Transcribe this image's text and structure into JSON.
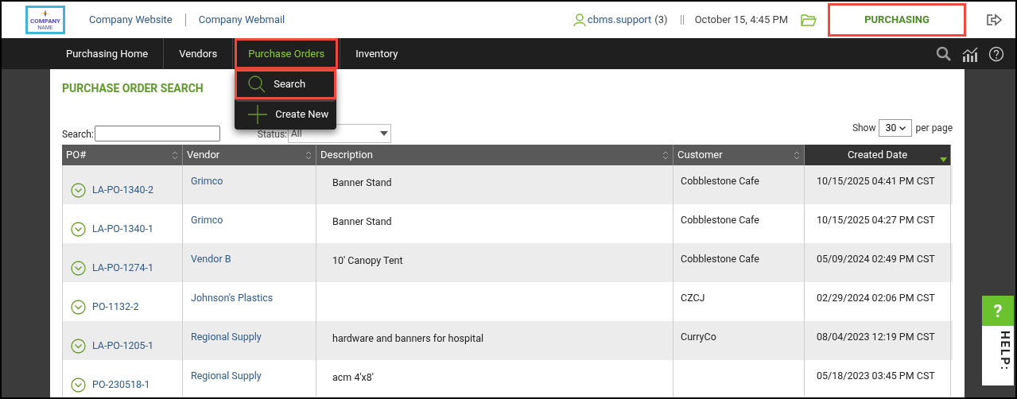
{
  "header": {
    "logo_text": "COMPANY",
    "logo_subtext": "NAME",
    "links": [
      "Company Website",
      "Company Webmail"
    ],
    "user": "cbms.support",
    "user_count": "(3)",
    "datetime": "October 15, 4:45 PM",
    "module": {
      "label": "PURCHASING",
      "highlighted": true
    }
  },
  "nav": {
    "items": [
      {
        "label": "Purchasing Home",
        "selected": false,
        "highlighted": false
      },
      {
        "label": "Vendors",
        "selected": false,
        "highlighted": false
      },
      {
        "label": "Purchase Orders",
        "selected": true,
        "highlighted": true
      },
      {
        "label": "Inventory",
        "selected": false,
        "highlighted": false
      }
    ]
  },
  "dropdown": [
    {
      "kind": "search",
      "label": "Search",
      "highlighted": true
    },
    {
      "kind": "create",
      "label": "Create New",
      "highlighted": false
    }
  ],
  "page": {
    "title": "PURCHASE ORDER SEARCH",
    "search_label": "Search:",
    "status_label": "Status:",
    "status_value": "All",
    "show_label": "Show",
    "per_page_value": "30",
    "per_page_label": "per page"
  },
  "table": {
    "columns": [
      {
        "label": "PO#",
        "sorted": false
      },
      {
        "label": "Vendor",
        "sorted": false
      },
      {
        "label": "Description",
        "sorted": false
      },
      {
        "label": "Customer",
        "sorted": false
      },
      {
        "label": "Created Date",
        "sorted": true
      }
    ],
    "rows": [
      {
        "po": "LA-PO-1340-2",
        "vendor": "Grimco",
        "description": "Banner Stand",
        "customer": "Cobblestone Cafe",
        "created": "10/15/2025 04:41 PM CST"
      },
      {
        "po": "LA-PO-1340-1",
        "vendor": "Grimco",
        "description": "Banner Stand",
        "customer": "Cobblestone Cafe",
        "created": "10/15/2025 04:27 PM CST"
      },
      {
        "po": "LA-PO-1274-1",
        "vendor": "Vendor B",
        "description": "10' Canopy Tent",
        "customer": "Cobblestone Cafe",
        "created": "05/09/2024 02:49 PM CST"
      },
      {
        "po": "PO-1132-2",
        "vendor": "Johnson's Plastics",
        "description": "",
        "customer": "CZCJ",
        "created": "02/29/2024 02:06 PM CST"
      },
      {
        "po": "LA-PO-1205-1",
        "vendor": "Regional Supply",
        "description": "hardware and banners for hospital",
        "customer": "CurryCo",
        "created": "08/04/2023 12:19 PM CST"
      },
      {
        "po": "PO-230518-1",
        "vendor": "Regional Supply",
        "description": "acm 4'x8'",
        "customer": "",
        "created": "05/18/2023 03:45 PM CST"
      }
    ]
  },
  "help_tab": {
    "icon": "?",
    "label": "HELP:"
  }
}
